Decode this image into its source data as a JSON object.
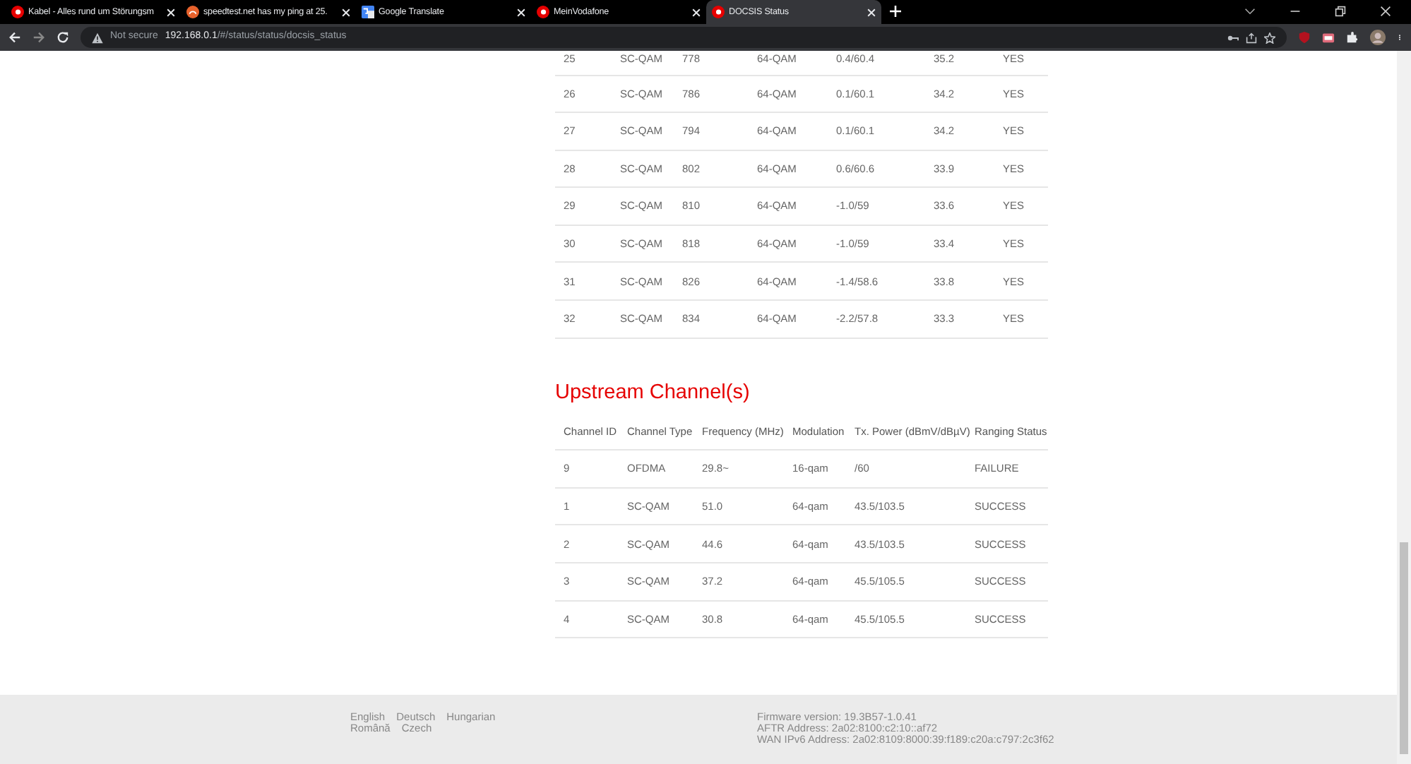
{
  "browser": {
    "tabs": [
      {
        "title": "Kabel - Alles rund um Störungsm",
        "kind": "vodafone",
        "selected": false
      },
      {
        "title": "speedtest.net has my ping at 25.",
        "kind": "speedtest",
        "selected": false
      },
      {
        "title": "Google Translate",
        "kind": "translate",
        "selected": false
      },
      {
        "title": "MeinVodafone",
        "kind": "vodafone",
        "selected": false
      },
      {
        "title": "DOCSIS Status",
        "kind": "vodafone",
        "selected": true
      }
    ],
    "security": "Not secure",
    "host": "192.168.0.1",
    "path": "/#/status/status/docsis_status"
  },
  "downstream": {
    "rows": [
      [
        "25",
        "SC-QAM",
        "778",
        "64-QAM",
        "0.4/60.4",
        "35.2",
        "YES"
      ],
      [
        "26",
        "SC-QAM",
        "786",
        "64-QAM",
        "0.1/60.1",
        "34.2",
        "YES"
      ],
      [
        "27",
        "SC-QAM",
        "794",
        "64-QAM",
        "0.1/60.1",
        "34.2",
        "YES"
      ],
      [
        "28",
        "SC-QAM",
        "802",
        "64-QAM",
        "0.6/60.6",
        "33.9",
        "YES"
      ],
      [
        "29",
        "SC-QAM",
        "810",
        "64-QAM",
        "-1.0/59",
        "33.6",
        "YES"
      ],
      [
        "30",
        "SC-QAM",
        "818",
        "64-QAM",
        "-1.0/59",
        "33.4",
        "YES"
      ],
      [
        "31",
        "SC-QAM",
        "826",
        "64-QAM",
        "-1.4/58.6",
        "33.8",
        "YES"
      ],
      [
        "32",
        "SC-QAM",
        "834",
        "64-QAM",
        "-2.2/57.8",
        "33.3",
        "YES"
      ]
    ]
  },
  "upstream": {
    "title": "Upstream Channel(s)",
    "columns": [
      "Channel ID",
      "Channel Type",
      "Frequency (MHz)",
      "Modulation",
      "Tx. Power (dBmV/dBµV)",
      "Ranging Status"
    ],
    "rows": [
      [
        "9",
        "OFDMA",
        "29.8~",
        "16-qam",
        "/60",
        "FAILURE"
      ],
      [
        "1",
        "SC-QAM",
        "51.0",
        "64-qam",
        "43.5/103.5",
        "SUCCESS"
      ],
      [
        "2",
        "SC-QAM",
        "44.6",
        "64-qam",
        "43.5/103.5",
        "SUCCESS"
      ],
      [
        "3",
        "SC-QAM",
        "37.2",
        "64-qam",
        "45.5/105.5",
        "SUCCESS"
      ],
      [
        "4",
        "SC-QAM",
        "30.8",
        "64-qam",
        "45.5/105.5",
        "SUCCESS"
      ]
    ]
  },
  "footer": {
    "languages": [
      "English",
      "Deutsch",
      "Hungarian",
      "Română",
      "Czech"
    ],
    "info": [
      "Firmware version: 19.3B57-1.0.41",
      "AFTR Address: 2a02:8100:c2:10::af72",
      "WAN IPv6 Address: 2a02:8109:8000:39:f189:c20a:c797:2c3f62"
    ]
  }
}
